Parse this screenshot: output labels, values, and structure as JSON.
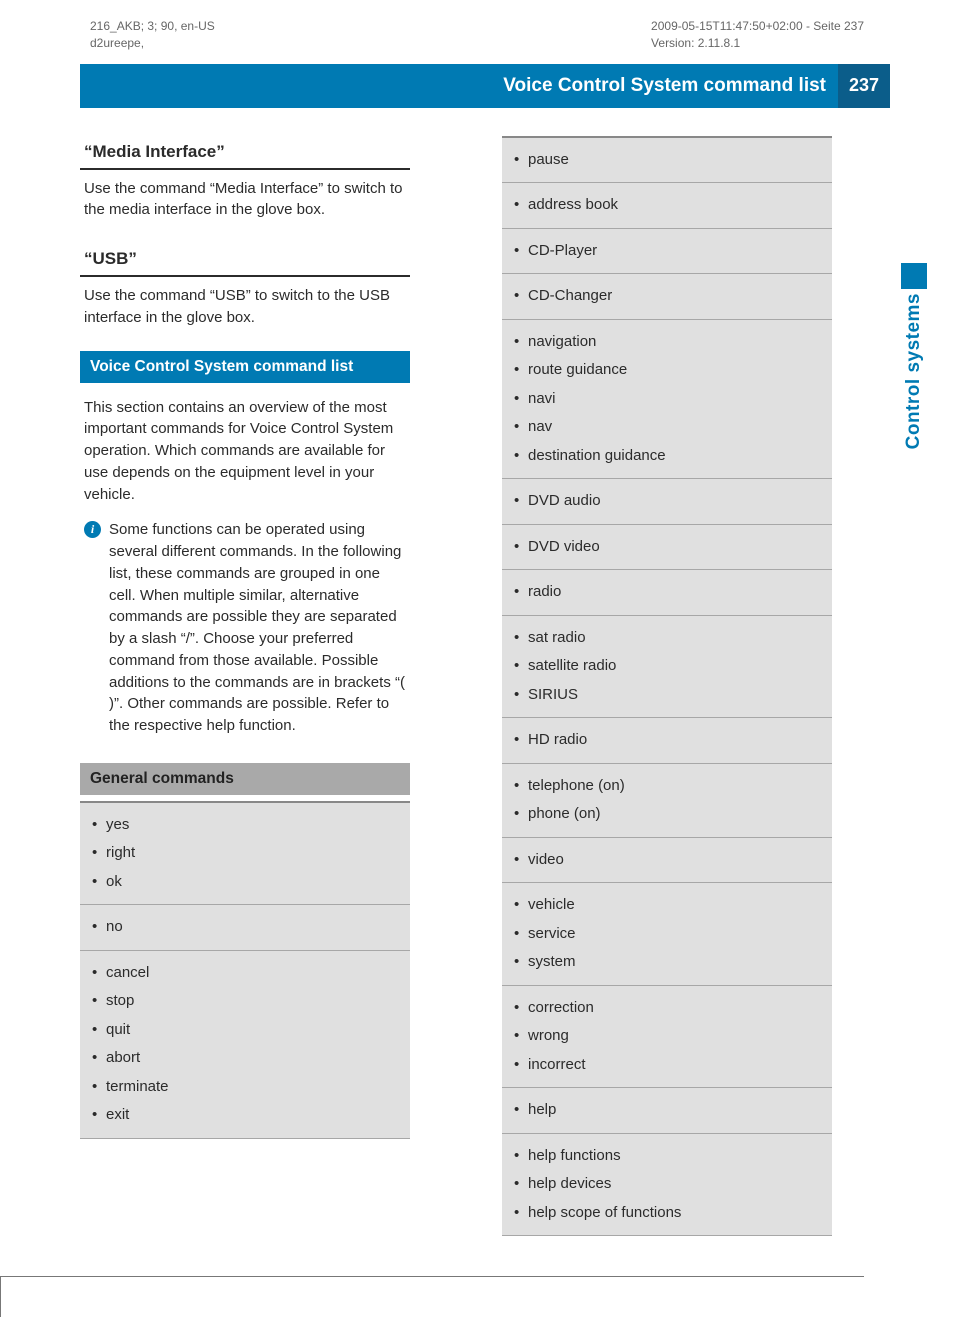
{
  "meta": {
    "left_line1": "216_AKB; 3; 90, en-US",
    "left_line2": "d2ureepe,",
    "right_line1": "2009-05-15T11:47:50+02:00 - Seite 237",
    "right_line2": "Version: 2.11.8.1"
  },
  "header": {
    "title": "Voice Control System command list",
    "page_number": "237"
  },
  "side_tab": "Control systems",
  "left_col": {
    "section1_heading": "“Media Interface”",
    "section1_body": "Use the command “Media Interface” to switch to the media interface in the glove box.",
    "section2_heading": "“USB”",
    "section2_body": "Use the command “USB” to switch to the USB interface in the glove box.",
    "blue_bar": "Voice Control System command list",
    "intro_para": "This section contains an overview of the most important commands for Voice Control System operation. Which commands are available for use depends on the equipment level in your vehicle.",
    "info_note": "Some functions can be operated using several different commands. In the following list, these commands are grouped in one cell. When multiple similar, alternative commands are possible they are separated by a slash “/”. Choose your preferred command from those available. Possible additions to the commands are in brackets “( )”. Other commands are possible. Refer to the respective help function.",
    "gray_bar": "General commands",
    "groups": [
      [
        "yes",
        "right",
        "ok"
      ],
      [
        "no"
      ],
      [
        "cancel",
        "stop",
        "quit",
        "abort",
        "terminate",
        "exit"
      ]
    ]
  },
  "right_col": {
    "groups": [
      [
        "pause"
      ],
      [
        "address book"
      ],
      [
        "CD-Player"
      ],
      [
        "CD-Changer"
      ],
      [
        "navigation",
        "route guidance",
        "navi",
        "nav",
        "destination guidance"
      ],
      [
        "DVD audio"
      ],
      [
        "DVD video"
      ],
      [
        "radio"
      ],
      [
        "sat radio",
        "satellite radio",
        "SIRIUS"
      ],
      [
        "HD radio"
      ],
      [
        "telephone (on)",
        "phone (on)"
      ],
      [
        "video"
      ],
      [
        "vehicle",
        "service",
        "system"
      ],
      [
        "correction",
        "wrong",
        "incorrect"
      ],
      [
        "help"
      ],
      [
        "help functions",
        "help devices",
        "help scope of functions"
      ]
    ]
  }
}
